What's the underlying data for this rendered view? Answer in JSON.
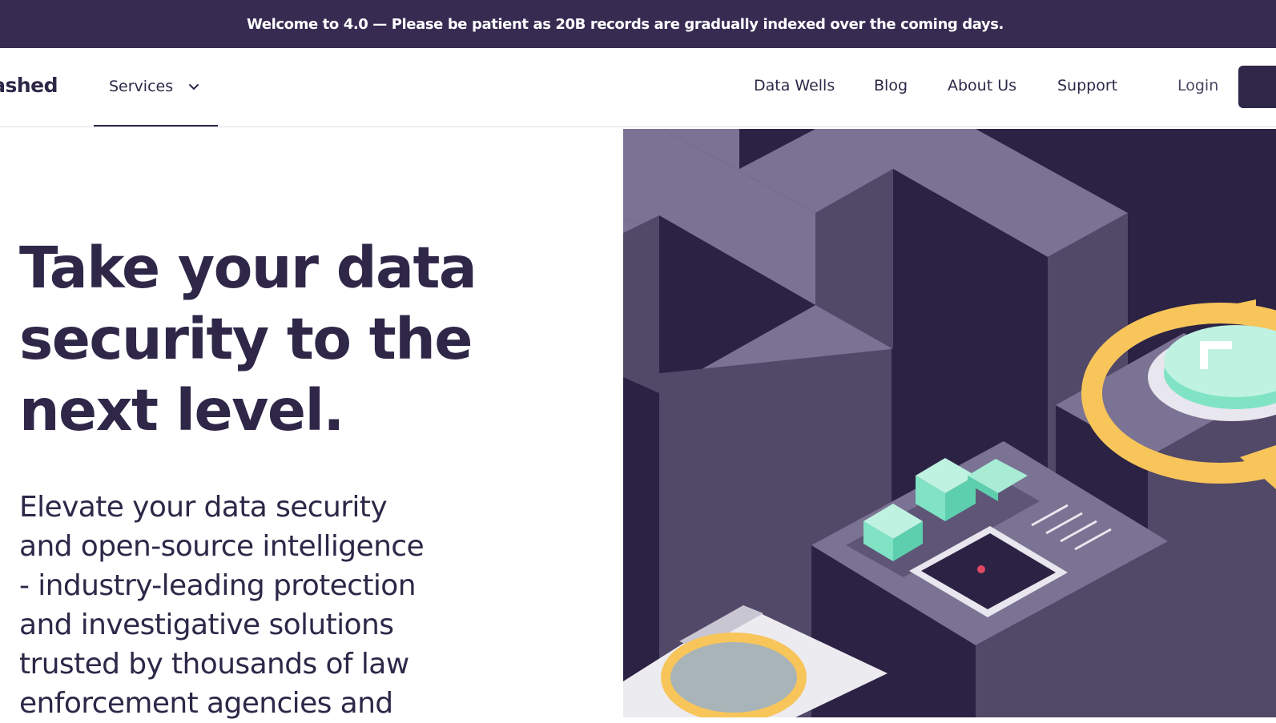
{
  "banner": {
    "text": "Welcome to 4.0 — Please be patient as 20B records are gradually indexed over the coming days."
  },
  "nav": {
    "brand": "ashed",
    "services_label": "Services",
    "links": [
      "Data Wells",
      "Blog",
      "About Us",
      "Support"
    ],
    "login_label": "Login"
  },
  "hero": {
    "headline_lines": [
      "Take your data",
      "security to the",
      "next level."
    ],
    "lede_lines": [
      "Elevate your data security",
      "and open-source intelligence",
      "- industry-leading protection",
      "and investigative solutions",
      "trusted by thousands of law",
      "enforcement agencies and"
    ]
  },
  "colors": {
    "primary": "#2f2748",
    "banner_bg": "#372b52",
    "illustration_bg": "#2c2344",
    "accent_mint": "#7fe3c4",
    "accent_gold": "#f7c55a"
  }
}
